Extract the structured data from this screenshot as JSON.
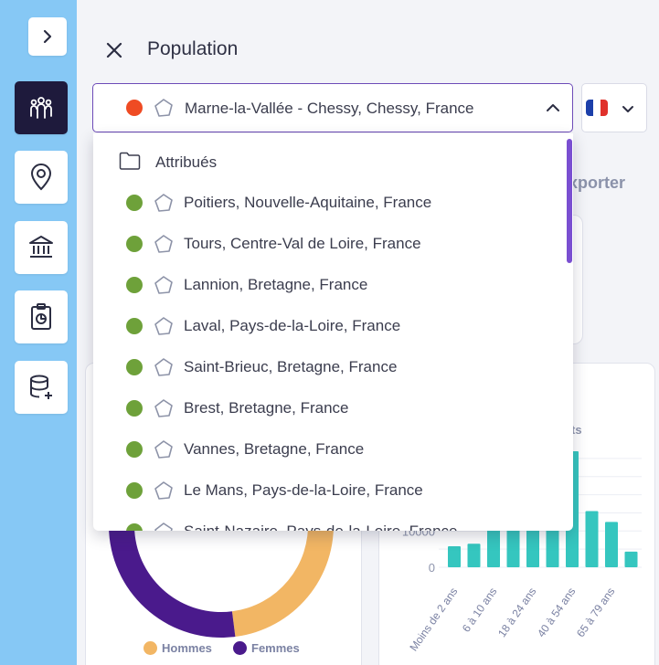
{
  "header": {
    "title": "Population",
    "selected_location": "Marne-la-Vallée - Chessy, Chessy, France",
    "exporter_label": "xporter"
  },
  "dropdown": {
    "group_label": "Attribués",
    "options": [
      "Poitiers, Nouvelle-Aquitaine, France",
      "Tours, Centre-Val de Loire, France",
      "Lannion, Bretagne, France",
      "Laval, Pays-de-la-Loire, France",
      "Saint-Brieuc, Bretagne, France",
      "Brest, Bretagne, France",
      "Vannes, Bretagne, France",
      "Le Mans, Pays-de-la-Loire, France",
      "Saint-Nazaire, Pays-de-la-Loire, France"
    ]
  },
  "legend": {
    "hommes": "Hommes",
    "femmes": "Femmes"
  },
  "chart_partial_label": "ts",
  "colors": {
    "rail": "#86c8f5",
    "accent": "#6d4bb8",
    "selected_dot": "#ef4b23",
    "option_dot": "#6ea13a",
    "hommes": "#f2b664",
    "femmes": "#4a1a8c",
    "bars": "#35c6bf"
  },
  "icons": {
    "rail": [
      "chevron-right-icon",
      "population-icon",
      "location-pin-icon",
      "bank-icon",
      "clipboard-chart-icon",
      "database-add-icon"
    ],
    "location": "polygon-icon",
    "group": "folder-icon"
  },
  "chart_data": [
    {
      "type": "pie",
      "categories": [
        "Hommes",
        "Femmes"
      ],
      "values": [
        48,
        52
      ]
    },
    {
      "type": "bar",
      "categories": [
        "Moins de 2 ans",
        "",
        "6 à 10 ans",
        "",
        "18 à 24 ans",
        "",
        "40 à 54 ans",
        "",
        "65 à 79 ans",
        ""
      ],
      "values": [
        5800,
        6500,
        10500,
        14500,
        17500,
        25000,
        32000,
        15500,
        12500,
        4300
      ],
      "yticks": [
        0,
        10000
      ],
      "ylim": [
        0,
        34000
      ]
    }
  ]
}
